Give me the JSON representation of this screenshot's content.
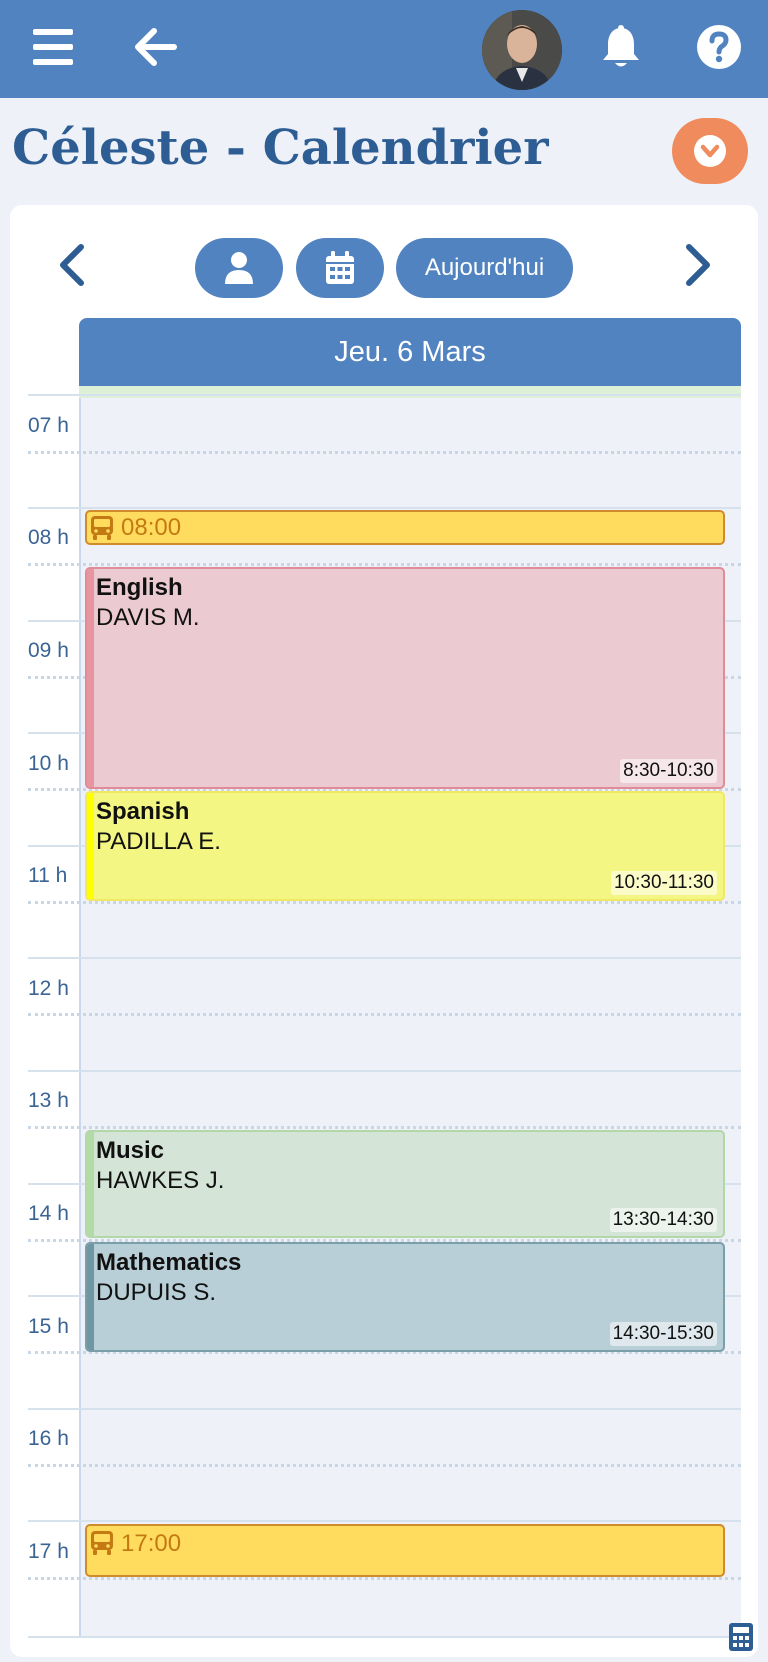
{
  "header": {
    "menu_icon": "hamburger-icon",
    "back_icon": "arrow-left-icon",
    "notifications_icon": "bell-icon",
    "help_icon": "question-icon",
    "brand_color": "#5183c0"
  },
  "page": {
    "title": "Céleste - Calendrier",
    "options_icon": "chevron-down-icon",
    "accent_color": "#ef8b5c"
  },
  "toolbar": {
    "prev_icon": "chevron-left-icon",
    "next_icon": "chevron-right-icon",
    "person_icon": "person-icon",
    "calendar_icon": "calendar-icon",
    "today_label": "Aujourd'hui"
  },
  "calendar": {
    "day_label": "Jeu. 6 Mars",
    "hours": [
      "07 h",
      "08 h",
      "09 h",
      "10 h",
      "11 h",
      "12 h",
      "13 h",
      "14 h",
      "15 h",
      "16 h",
      "17 h"
    ],
    "bus_events": [
      {
        "time": "08:00",
        "icon": "bus-icon"
      },
      {
        "time": "17:00",
        "icon": "bus-icon"
      }
    ],
    "lessons": [
      {
        "subject": "English",
        "teacher": "DAVIS M.",
        "time": "8:30-10:30",
        "bg": "#ebcbd1",
        "border": "#e08b97",
        "bar": "#e7959f"
      },
      {
        "subject": "Spanish",
        "teacher": "PADILLA E.",
        "time": "10:30-11:30",
        "bg": "#f3f683",
        "border": "#f1e862",
        "bar": "#ffff00"
      },
      {
        "subject": "Music",
        "teacher": "HAWKES J.",
        "time": "13:30-14:30",
        "bg": "#d4e5d7",
        "border": "#b5d6a9",
        "bar": "#b2dba5"
      },
      {
        "subject": "Mathematics",
        "teacher": "DUPUIS S.",
        "time": "14:30-15:30",
        "bg": "#b8cfd8",
        "border": "#7b9fa9",
        "bar": "#6e97a1"
      }
    ],
    "footer_icon": "calculator-icon"
  }
}
